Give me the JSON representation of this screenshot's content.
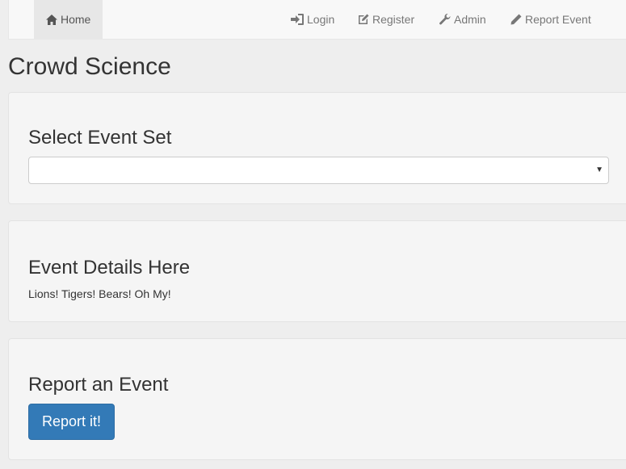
{
  "nav": {
    "home": "Home",
    "login": "Login",
    "register": "Register",
    "admin": "Admin",
    "report_event": "Report Event"
  },
  "page_title": "Crowd Science",
  "event_set": {
    "heading": "Select Event Set",
    "selected_value": ""
  },
  "event_details": {
    "heading": "Event Details Here",
    "text": "Lions! Tigers! Bears! Oh My!"
  },
  "report": {
    "heading": "Report an Event",
    "button_label": "Report it!"
  },
  "colors": {
    "primary": "#337ab7",
    "background": "#eeeeee",
    "panel": "#f5f5f5",
    "navbar": "#f8f8f8"
  },
  "icons": [
    "home-icon",
    "login-icon",
    "edit-icon",
    "wrench-icon",
    "pencil-icon",
    "caret-down-icon"
  ]
}
